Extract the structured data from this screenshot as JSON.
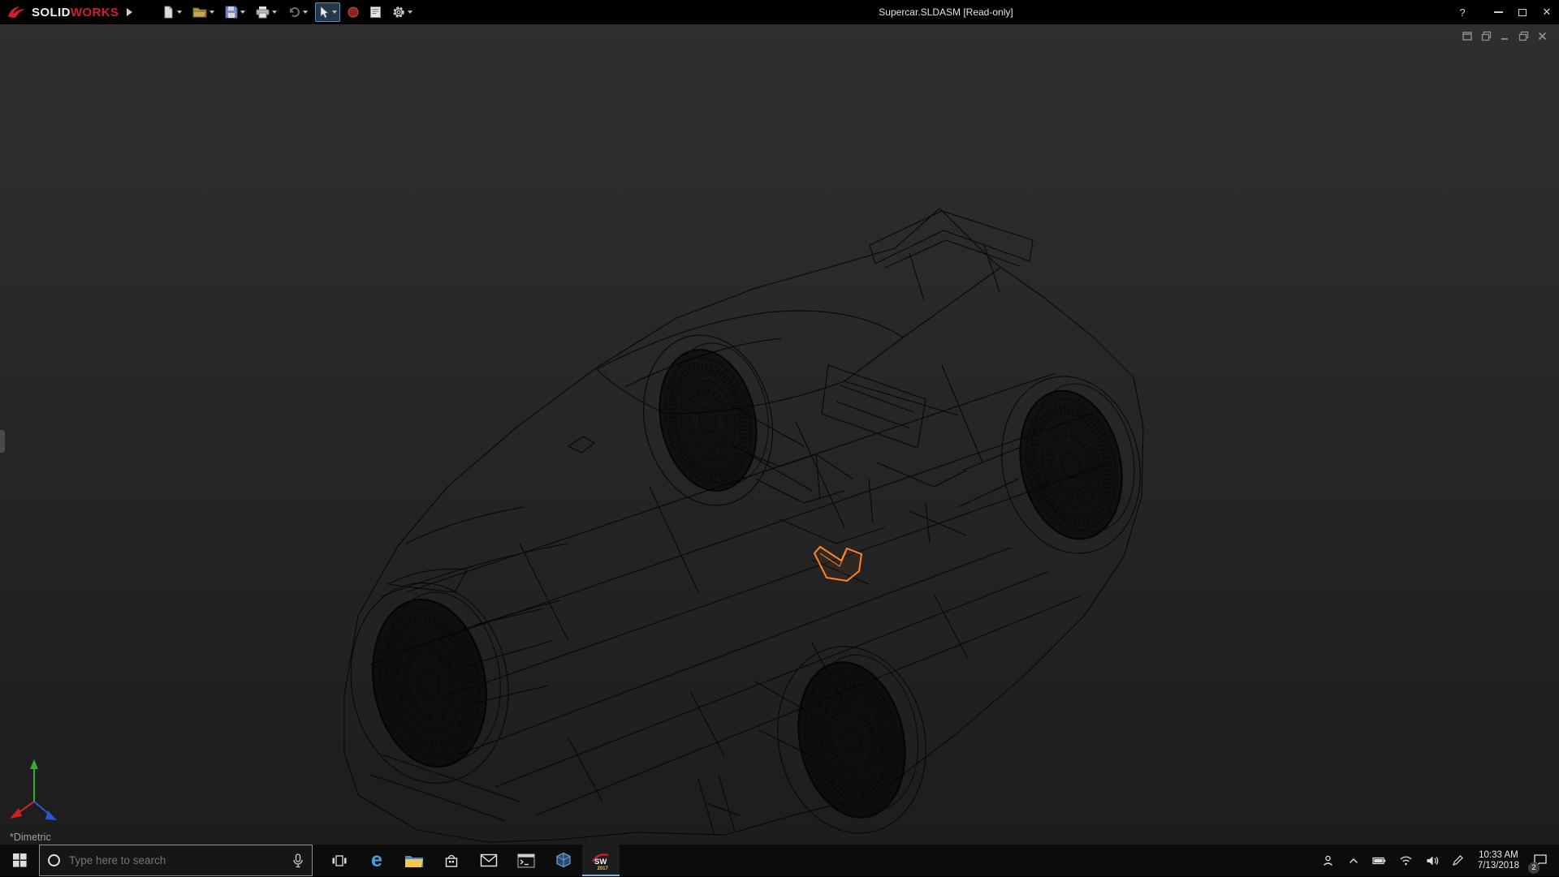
{
  "titlebar": {
    "brand": {
      "solid": "SOLID",
      "works": "WORKS"
    },
    "title": "Supercar.SLDASM [Read-only]",
    "controls": {
      "help": "?",
      "close": "✕"
    }
  },
  "viewport": {
    "model": "Supercar wireframe assembly",
    "view_orientation": "*Dimetric",
    "selection_color": "#ff8426"
  },
  "taskbar": {
    "search_placeholder": "Type here to search",
    "edge_glyph": "e",
    "solidworks": {
      "label": "SW",
      "year": "2017"
    },
    "tray": {
      "time": "10:33 AM",
      "date": "7/13/2018",
      "notification_count": "2"
    }
  }
}
